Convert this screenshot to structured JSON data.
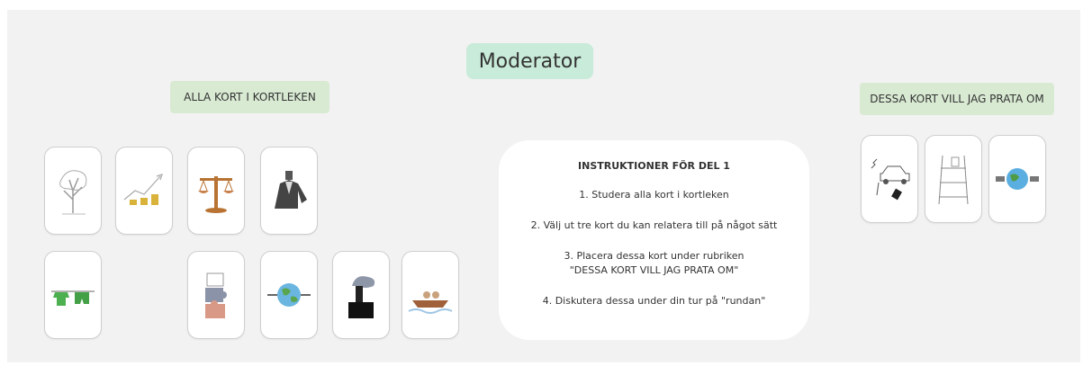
{
  "board": {
    "title": "Moderator",
    "deck_label": "ALLA KORT I KORTLEKEN",
    "selected_label": "DESSA KORT VILL JAG PRATA OM"
  },
  "instructions": {
    "title": "INSTRUKTIONER FÖR DEL 1",
    "step1": "1. Studera alla kort i kortleken",
    "step2": "2. Välj ut tre kort du kan relatera till på något sätt",
    "step3_line1": "3. Placera dessa kort under rubriken",
    "step3_line2": "\"DESSA KORT VILL JAG PRATA OM\"",
    "step4": "4. Diskutera dessa under din tur på \"rundan\""
  },
  "deck_cards": [
    {
      "icon": "dead-tree-icon"
    },
    {
      "icon": "growth-coins-icon"
    },
    {
      "icon": "balance-scale-icon"
    },
    {
      "icon": "businessman-suit-icon"
    },
    {
      "icon": "clothesline-icon"
    },
    {
      "icon": "puzzle-pieces-icon"
    },
    {
      "icon": "connected-earth-icon"
    },
    {
      "icon": "smoking-factory-icon"
    },
    {
      "icon": "boat-on-water-icon"
    }
  ],
  "selected_cards": [
    {
      "icon": "electric-car-icon"
    },
    {
      "icon": "ladder-shelves-icon"
    },
    {
      "icon": "plugged-earth-icon"
    }
  ],
  "colors": {
    "board_bg": "#f2f2f2",
    "label_bg": "#d9ead3",
    "moderator_bg": "#c9ebd9"
  }
}
